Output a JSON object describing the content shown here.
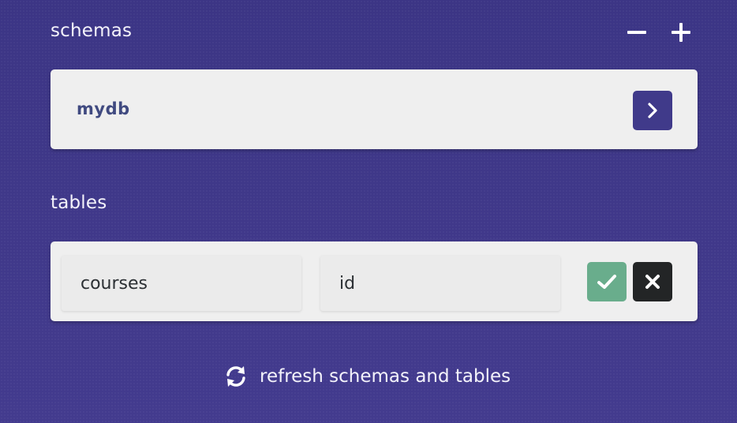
{
  "schemas": {
    "label": "schemas",
    "remove_icon": "minus-icon",
    "add_icon": "plus-icon",
    "items": [
      {
        "name": "mydb",
        "open_icon": "chevron-right-icon"
      }
    ]
  },
  "tables": {
    "label": "tables",
    "row": {
      "table_name": "courses",
      "key_column": "id",
      "confirm_icon": "check-icon",
      "cancel_icon": "close-icon"
    }
  },
  "refresh": {
    "label": "refresh schemas and tables",
    "icon": "refresh-icon"
  },
  "colors": {
    "background": "#3f3886",
    "card": "#efefef",
    "accent": "#403a8a",
    "schema_text": "#404a80",
    "confirm": "#69ad8c",
    "cancel": "#232526"
  }
}
